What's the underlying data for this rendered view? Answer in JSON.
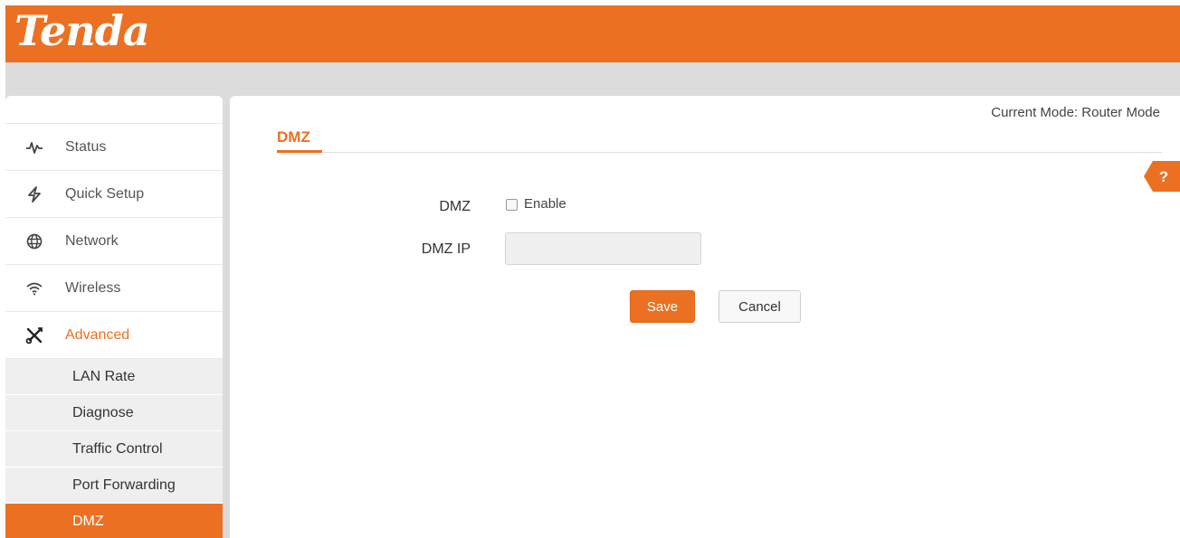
{
  "brand": {
    "logo_text": "Tenda",
    "accent_color": "#ec7021"
  },
  "header": {
    "mode_text": "Current Mode: Router Mode"
  },
  "sidebar": {
    "items": [
      {
        "label": "Status",
        "icon": "pulse-icon"
      },
      {
        "label": "Quick Setup",
        "icon": "lightning-icon"
      },
      {
        "label": "Network",
        "icon": "globe-icon"
      },
      {
        "label": "Wireless",
        "icon": "wifi-icon"
      },
      {
        "label": "Advanced",
        "icon": "tools-icon",
        "active": true
      }
    ],
    "sub_items": [
      {
        "label": "LAN Rate"
      },
      {
        "label": "Diagnose"
      },
      {
        "label": "Traffic Control"
      },
      {
        "label": "Port Forwarding"
      },
      {
        "label": "DMZ",
        "active": true
      }
    ]
  },
  "page": {
    "title": "DMZ",
    "help_label": "?",
    "form": {
      "dmz_label": "DMZ",
      "enable_label": "Enable",
      "enable_checked": false,
      "dmz_ip_label": "DMZ IP",
      "dmz_ip_value": ""
    },
    "buttons": {
      "save": "Save",
      "cancel": "Cancel"
    }
  }
}
